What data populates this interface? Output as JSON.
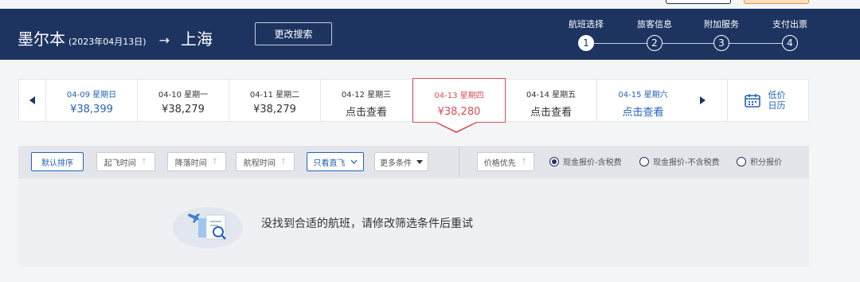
{
  "header": {
    "origin": "墨尔本",
    "date": "(2023年04月13日)",
    "arrow": "→",
    "destination": "上海",
    "modify_label": "更改搜索",
    "steps": [
      {
        "label": "航班选择",
        "num": "1",
        "active": true
      },
      {
        "label": "旅客信息",
        "num": "2",
        "active": false
      },
      {
        "label": "附加服务",
        "num": "3",
        "active": false
      },
      {
        "label": "支付出票",
        "num": "4",
        "active": false
      }
    ]
  },
  "datebar": {
    "prev_icon": "triangle-left-icon",
    "next_icon": "triangle-right-icon",
    "days": [
      {
        "date": "04-09 星期日",
        "price": "¥38,399"
      },
      {
        "date": "04-10 星期一",
        "price": "¥38,279"
      },
      {
        "date": "04-11 星期二",
        "price": "¥38,279"
      },
      {
        "date": "04-12 星期三",
        "price": "点击查看"
      },
      {
        "date": "04-13 星期四",
        "price": "¥38,280"
      },
      {
        "date": "04-14 星期五",
        "price": "点击查看"
      },
      {
        "date": "04-15 星期六",
        "price": "点击查看"
      }
    ],
    "calendar_label_1": "低价",
    "calendar_label_2": "日历"
  },
  "filters": {
    "default_sort": "默认排序",
    "depart_time": "起飞时间",
    "arrive_time": "降落时间",
    "duration": "航程时间",
    "direct_only": "只看直飞",
    "more": "更多条件",
    "price_first": "价格优先",
    "up_arrow": "↑",
    "radios": [
      {
        "label": "现金报价-含税费",
        "checked": true
      },
      {
        "label": "现金报价-不含税费",
        "checked": false
      },
      {
        "label": "积分报价",
        "checked": false
      }
    ]
  },
  "empty": {
    "message": "没找到合适的航班，请修改筛选条件后重试"
  },
  "colors": {
    "header_bg": "#1d3461",
    "accent_blue": "#2463b7",
    "accent_red": "#d94e58"
  }
}
